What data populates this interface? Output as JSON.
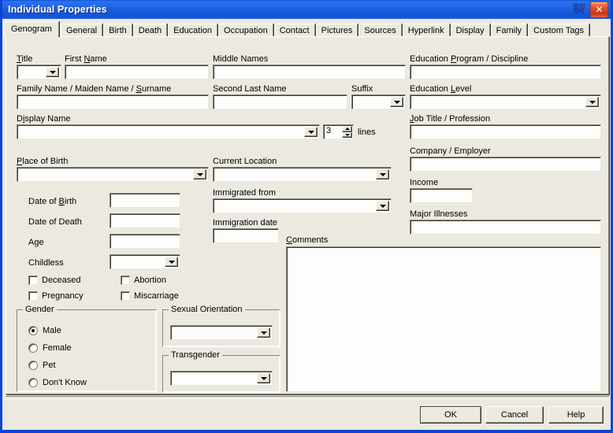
{
  "window": {
    "title": "Individual Properties",
    "ime_indicator": "IME",
    "close_label": "✕"
  },
  "tabs": [
    {
      "label": "Genogram",
      "selected": true
    },
    {
      "label": "General",
      "selected": false
    },
    {
      "label": "Birth",
      "selected": false
    },
    {
      "label": "Death",
      "selected": false
    },
    {
      "label": "Education",
      "selected": false
    },
    {
      "label": "Occupation",
      "selected": false
    },
    {
      "label": "Contact",
      "selected": false
    },
    {
      "label": "Pictures",
      "selected": false
    },
    {
      "label": "Sources",
      "selected": false
    },
    {
      "label": "Hyperlink",
      "selected": false
    },
    {
      "label": "Display",
      "selected": false
    },
    {
      "label": "Family",
      "selected": false
    },
    {
      "label": "Custom Tags",
      "selected": false
    }
  ],
  "fields": {
    "title_label": "Title",
    "title_value": "",
    "first_name_label": "First Name",
    "first_name_value": "",
    "middle_names_label": "Middle Names",
    "middle_names_value": "",
    "education_program_label": "Education Program / Discipline",
    "education_program_value": "",
    "family_name_label": "Family Name / Maiden Name / Surname",
    "family_name_value": "",
    "second_last_name_label": "Second Last Name",
    "second_last_name_value": "",
    "suffix_label": "Suffix",
    "suffix_value": "",
    "education_level_label": "Education Level",
    "education_level_value": "",
    "display_name_label": "Display Name",
    "display_name_value": "",
    "lines_value": "3",
    "lines_label": "lines",
    "job_title_label": "Job Title / Profession",
    "job_title_value": "",
    "place_of_birth_label": "Place of Birth",
    "place_of_birth_value": "",
    "current_location_label": "Current Location",
    "current_location_value": "",
    "company_label": "Company / Employer",
    "company_value": "",
    "date_of_birth_label": "Date of Birth",
    "date_of_birth_value": "",
    "date_of_death_label": "Date of Death",
    "date_of_death_value": "",
    "age_label": "Age",
    "age_value": "",
    "childless_label": "Childless",
    "childless_value": "",
    "immigrated_from_label": "Immigrated from",
    "immigrated_from_value": "",
    "immigration_date_label": "Immigration date",
    "immigration_date_value": "",
    "income_label": "Income",
    "income_value": "",
    "major_illnesses_label": "Major Illnesses",
    "major_illnesses_value": "",
    "comments_label": "Comments",
    "comments_value": ""
  },
  "checkboxes": [
    {
      "label": "Deceased",
      "checked": false
    },
    {
      "label": "Pregnancy",
      "checked": false
    },
    {
      "label": "Abortion",
      "checked": false
    },
    {
      "label": "Miscarriage",
      "checked": false
    }
  ],
  "gender_group": {
    "title": "Gender",
    "options": [
      {
        "label": "Male",
        "selected": true
      },
      {
        "label": "Female",
        "selected": false
      },
      {
        "label": "Pet",
        "selected": false
      },
      {
        "label": "Don't Know",
        "selected": false
      }
    ]
  },
  "sexual_orientation_group": {
    "title": "Sexual Orientation",
    "value": ""
  },
  "transgender_group": {
    "title": "Transgender",
    "value": ""
  },
  "footer": {
    "ok_label": "OK",
    "cancel_label": "Cancel",
    "help_label": "Help"
  },
  "colors": {
    "titlebar_blue": "#1a5ce0",
    "window_border": "#0a46d2",
    "dialog_face": "#ece9e0",
    "field_bg": "#fdfdfb",
    "close_red": "#c93813"
  }
}
